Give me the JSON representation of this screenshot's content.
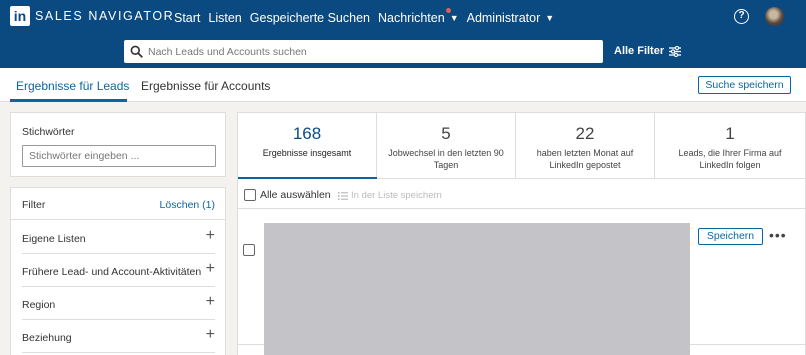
{
  "header": {
    "logo_in": "in",
    "logo_text": "SALES NAVIGATOR",
    "nav": [
      {
        "label": "Start"
      },
      {
        "label": "Listen"
      },
      {
        "label": "Gespeicherte Suchen"
      },
      {
        "label": "Nachrichten"
      },
      {
        "label": "Administrator"
      }
    ],
    "help_glyph": "?",
    "icons": {
      "help": "help-circle-icon",
      "avatar": "user-avatar"
    },
    "colors": {
      "brand": "#0a4a80",
      "accent": "#0a66a0",
      "notification": "#e06050"
    }
  },
  "search": {
    "placeholder": "Nach Leads und Accounts suchen",
    "all_filters_label": "Alle Filter"
  },
  "tabs": {
    "leads": "Ergebnisse für Leads",
    "accounts": "Ergebnisse für Accounts",
    "save_search": "Suche speichern"
  },
  "keywords": {
    "title": "Stichwörter",
    "placeholder": "Stichwörter eingeben ..."
  },
  "filters": {
    "title": "Filter",
    "clear_label": "Löschen (1)",
    "items": [
      {
        "label": "Eigene Listen"
      },
      {
        "label": "Frühere Lead- und Account-Aktivitäten"
      },
      {
        "label": "Region"
      },
      {
        "label": "Beziehung"
      }
    ],
    "plus_glyph": "+"
  },
  "stats": [
    {
      "number": "168",
      "label": "Ergebnisse insgesamt"
    },
    {
      "number": "5",
      "label": "Jobwechsel in den letzten 90 Tagen"
    },
    {
      "number": "22",
      "label": "haben letzten Monat auf LinkedIn gepostet"
    },
    {
      "number": "1",
      "label": "Leads, die Ihrer Firma auf LinkedIn folgen"
    }
  ],
  "select_bar": {
    "select_all": "Alle auswählen",
    "save_to_list": "In der Liste speichern"
  },
  "result": {
    "save_label": "Speichern",
    "more_glyph": "•••"
  }
}
